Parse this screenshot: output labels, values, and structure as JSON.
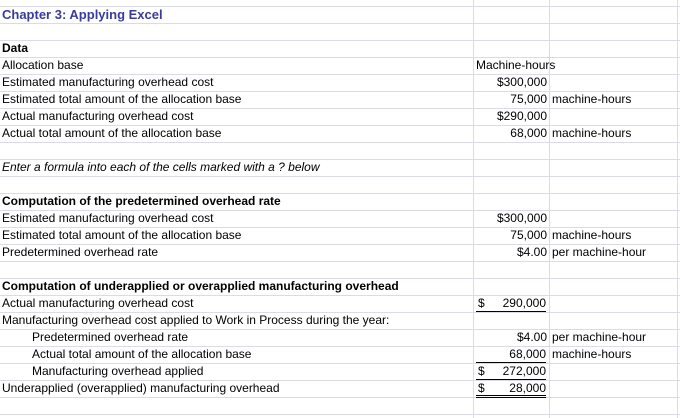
{
  "sheet": {
    "title": "Chapter 3: Applying Excel",
    "data_header": "Data",
    "data_rows": [
      {
        "label": "Allocation base",
        "value": "Machine-hours",
        "unit": ""
      },
      {
        "label": "Estimated manufacturing overhead cost",
        "value": "$300,000",
        "unit": ""
      },
      {
        "label": "Estimated total amount of the allocation base",
        "value": "75,000",
        "unit": "machine-hours"
      },
      {
        "label": "Actual manufacturing overhead cost",
        "value": "$290,000",
        "unit": ""
      },
      {
        "label": "Actual total amount of the allocation base",
        "value": "68,000",
        "unit": "machine-hours"
      }
    ],
    "instruction": "Enter a formula into each of the cells marked with a ? below",
    "predetermined": {
      "header": "Computation of the predetermined overhead rate",
      "rows": [
        {
          "label": "Estimated manufacturing overhead cost",
          "value": "$300,000",
          "unit": ""
        },
        {
          "label": "Estimated total amount of the allocation base",
          "value": "75,000",
          "unit": "machine-hours"
        },
        {
          "label": "Predetermined overhead rate",
          "value": "$4.00",
          "unit": "per machine-hour"
        }
      ]
    },
    "applied": {
      "header": "Computation of underapplied or overapplied manufacturing overhead",
      "actual_label": "Actual manufacturing overhead cost",
      "actual_sign": "$",
      "actual_value": "290,000",
      "applied_label": "Manufacturing overhead cost applied to Work in Process during the year:",
      "rate_label": "Predetermined overhead rate",
      "rate_value": "$4.00",
      "rate_unit": "per machine-hour",
      "base_label": "Actual total amount of the allocation base",
      "base_value": "68,000",
      "base_unit": "machine-hours",
      "mo_label": "Manufacturing overhead applied",
      "mo_sign": "$",
      "mo_value": "272,000",
      "under_label": "Underapplied (overapplied) manufacturing overhead",
      "under_sign": "$",
      "under_value": "28,000"
    }
  }
}
